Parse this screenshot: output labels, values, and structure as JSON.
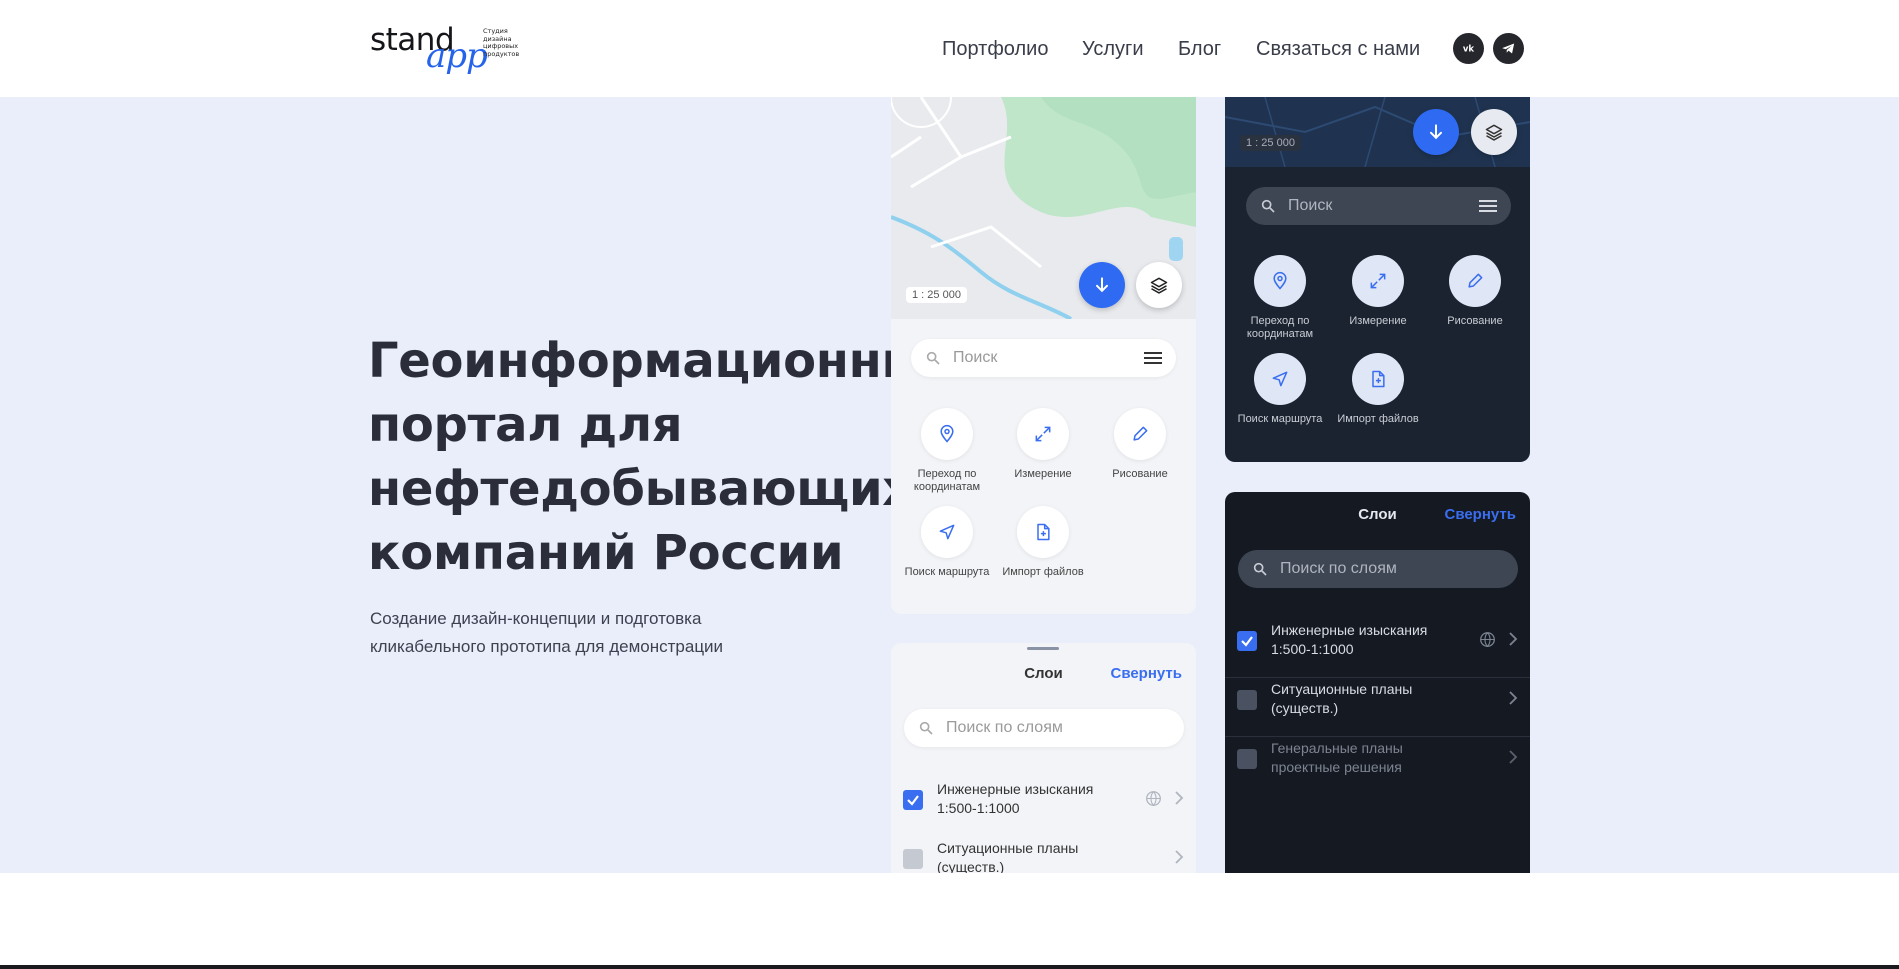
{
  "logo": {
    "word1": "stand",
    "word2": "app",
    "tagline": "Студия дизайна цифровых продуктов"
  },
  "nav": {
    "items": [
      {
        "label": "Портфолио"
      },
      {
        "label": "Услуги"
      },
      {
        "label": "Блог"
      },
      {
        "label": "Связаться с нами"
      }
    ],
    "social": [
      {
        "icon": "vk-icon"
      },
      {
        "icon": "telegram-icon"
      }
    ]
  },
  "hero": {
    "title_lines": [
      "Геоинформационный",
      "портал для",
      "нефтедобывающих",
      "компаний России"
    ],
    "subtitle_lines": [
      "Создание дизайн-концепции и подготовка",
      "кликабельного прототипа для демонстрации"
    ]
  },
  "mockups": {
    "scale": "1 : 25 000",
    "search_placeholder": "Поиск",
    "tools": [
      {
        "label": "Переход по координатам",
        "icon": "location-pin-icon"
      },
      {
        "label": "Измерение",
        "icon": "expand-arrows-icon"
      },
      {
        "label": "Рисование",
        "icon": "pencil-icon"
      },
      {
        "label": "Поиск маршрута",
        "icon": "navigation-arrow-icon"
      },
      {
        "label": "Импорт файлов",
        "icon": "file-plus-icon"
      }
    ],
    "layers_title": "Слои",
    "collapse_label": "Свернуть",
    "layers_search_placeholder": "Поиск по слоям",
    "layers": [
      {
        "label": "Инженерные изыскания 1:500-1:1000",
        "checked": true
      },
      {
        "label": "Ситуационные планы (существ.)",
        "checked": false
      },
      {
        "label": "Генеральные планы проектные решения",
        "checked": false
      }
    ]
  },
  "colors": {
    "accent": "#2f6bf2",
    "hero_bg": "#e9eefa",
    "dark_panel": "#1b2330"
  }
}
